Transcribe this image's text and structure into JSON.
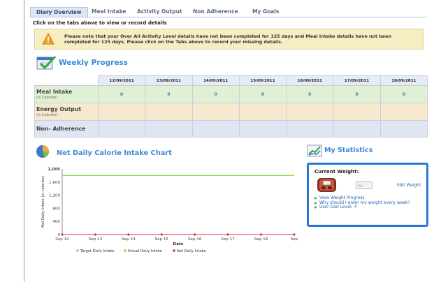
{
  "tabs": [
    {
      "label": "Diary Overview",
      "active": true
    },
    {
      "label": "Meal Intake",
      "active": false
    },
    {
      "label": "Activity Output",
      "active": false
    },
    {
      "label": "Non Adherence",
      "active": false
    },
    {
      "label": "My Goals",
      "active": false
    }
  ],
  "instructions": "Click on the tabs above to view or record details",
  "notice": {
    "message": "Please note that your Over All Activity Level details have not been completed for 125 days and Meal Intake details have not been completed for 125 days. Please click on the Tabs above to record your missing details."
  },
  "weekly": {
    "title": "Weekly Progress",
    "dates": [
      "12/09/2011",
      "13/09/2011",
      "14/09/2011",
      "15/09/2011",
      "16/09/2011",
      "17/09/2011",
      "18/09/2011"
    ],
    "rows": [
      {
        "label": "Meal Intake",
        "sub": "(in Calories)",
        "values": [
          "0",
          "0",
          "0",
          "0",
          "0",
          "0",
          "0"
        ]
      },
      {
        "label": "Energy Output",
        "sub": "(in Calories)",
        "values": [
          "",
          "",
          "",
          "",
          "",
          "",
          ""
        ]
      },
      {
        "label": "Non- Adherence",
        "sub": "",
        "values": [
          "",
          "",
          "",
          "",
          "",
          "",
          ""
        ]
      }
    ]
  },
  "chart": {
    "title": "Net Daily Calorie Intake Chart"
  },
  "chart_data": {
    "type": "line",
    "x": [
      "Sep 12",
      "Sep 13",
      "Sep 14",
      "Sep 15",
      "Sep 16",
      "Sep 17",
      "Sep 18",
      "Sep"
    ],
    "xlabel": "Date",
    "ylabel": "Net Daily Intake (in calories)",
    "ylim": [
      0,
      2000
    ],
    "yticks": [
      "0",
      "400",
      "800",
      "1,200",
      "1,600",
      "2,000"
    ],
    "series": [
      {
        "name": "Target Daily Intake",
        "color": "#9bd85a",
        "values": [
          1800,
          1800,
          1800,
          1800,
          1800,
          1800,
          1800,
          1800
        ]
      },
      {
        "name": "Actual Daily Intake",
        "color": "#f3a73a",
        "values": [
          0,
          0,
          0,
          0,
          0,
          0,
          0,
          0
        ]
      },
      {
        "name": "Net Daily Intake",
        "color": "#e0303a",
        "values": [
          0,
          0,
          0,
          0,
          0,
          0,
          0,
          0
        ]
      }
    ],
    "grid": false,
    "legend": "bottom"
  },
  "stats": {
    "title": "My Statistics",
    "current_weight_label": "Current Weight:",
    "weight_value": "65",
    "edit_label": "Edit Weight",
    "links": [
      "View Weight Progress",
      "Why should I enter my weight every week?",
      "User Diet Level: 4"
    ]
  },
  "icons": {
    "warning": "warning-icon",
    "weekly": "calendar-check-icon",
    "chart": "pie-chart-icon",
    "stats": "line-chart-icon",
    "scale": "bathroom-scale-icon"
  },
  "colors": {
    "accent": "#3b8ad6",
    "stats_border": "#2b78d0",
    "notice_bg": "#f6eec2",
    "meal_row": "#dff0d4",
    "energy_row": "#f7e9cf",
    "non_row": "#dfe5f2"
  }
}
